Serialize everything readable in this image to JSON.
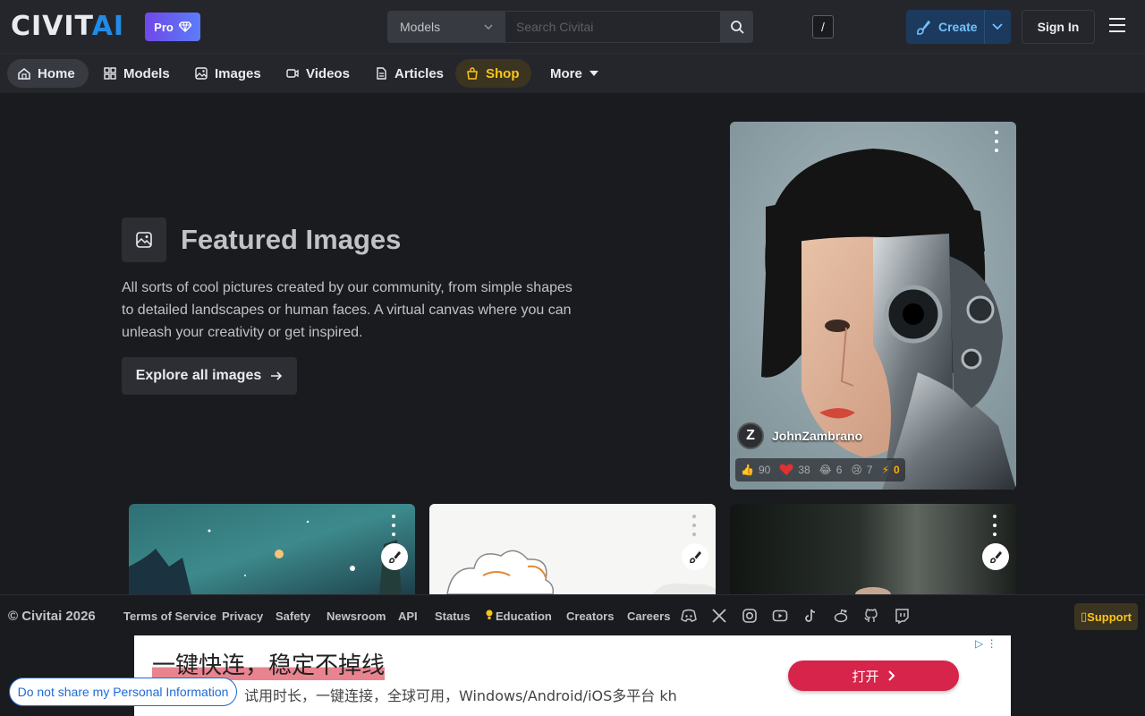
{
  "header": {
    "logo_part1": "CIVIT",
    "logo_part2": "AI",
    "pro_label": "Pro",
    "search_type": "Models",
    "search_placeholder": "Search Civitai",
    "search_shortcut": "/",
    "create_label": "Create",
    "signin_label": "Sign In"
  },
  "nav": {
    "items": [
      {
        "label": "Home"
      },
      {
        "label": "Models"
      },
      {
        "label": "Images"
      },
      {
        "label": "Videos"
      },
      {
        "label": "Articles"
      },
      {
        "label": "Shop"
      },
      {
        "label": "More"
      }
    ]
  },
  "featured": {
    "title": "Featured Images",
    "description": "All sorts of cool pictures created by our community, from simple shapes to detailed landscapes or human faces. A virtual canvas where you can unleash your creativity or get inspired.",
    "button_label": "Explore all images"
  },
  "hero_card": {
    "avatar_letter": "Z",
    "username": "JohnZambrano",
    "reactions": {
      "like": "90",
      "heart": "38",
      "laugh": "6",
      "cry": "7",
      "buzz": "0"
    }
  },
  "footer": {
    "copyright": "© Civitai 2026",
    "links": [
      "Terms of Service",
      "Privacy",
      "Safety",
      "Newsroom",
      "API",
      "Status",
      "Education",
      "Creators",
      "Careers"
    ],
    "support_label": "Support"
  },
  "ad": {
    "headline": "一键快连，稳定不掉线",
    "subtext": "试用时长，一键连接，全球可用，Windows/Android/iOS多平台 kh",
    "button_label": "打开"
  },
  "privacy_label": "Do not share my Personal Information",
  "colors": {
    "background": "#1a1b1e",
    "header": "#25262b",
    "accent_blue": "#228be6",
    "shop_yellow": "#fcc419",
    "pro_purple": "#7048e8"
  }
}
